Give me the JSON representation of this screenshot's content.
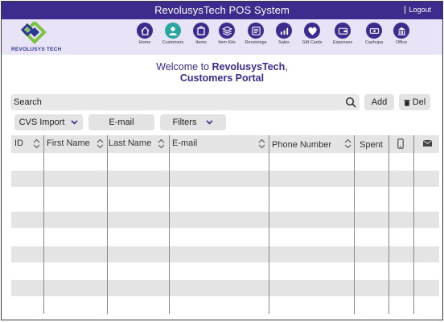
{
  "window": {
    "title": "RevolusysTech POS System",
    "logout_label": "Logout"
  },
  "brand": {
    "logo_text": "REVOLUSYS TECH"
  },
  "nav": [
    {
      "label": "Home",
      "icon": "home-icon"
    },
    {
      "label": "Customers",
      "icon": "customers-icon",
      "active": true
    },
    {
      "label": "Items",
      "icon": "items-icon"
    },
    {
      "label": "Item Kits",
      "icon": "item-kits-icon"
    },
    {
      "label": "Receivings",
      "icon": "receivings-icon"
    },
    {
      "label": "Sales",
      "icon": "sales-icon"
    },
    {
      "label": "Gift Cards",
      "icon": "gift-cards-icon"
    },
    {
      "label": "Expenses",
      "icon": "expenses-icon"
    },
    {
      "label": "Cashupa",
      "icon": "cashup-icon"
    },
    {
      "label": "Office",
      "icon": "office-icon"
    }
  ],
  "welcome": {
    "prefix": "Welcome to ",
    "brand": "RevolusysTech",
    "suffix": ",",
    "line2": "Customers Portal"
  },
  "search": {
    "placeholder": "Search",
    "value": ""
  },
  "toolbar": {
    "add_label": "Add",
    "delete_label": "Del",
    "cvs_import_label": "CVS Import",
    "email_label": "E-mail",
    "filters_label": "Filters"
  },
  "table": {
    "columns": [
      "ID",
      "First Name",
      "Last Name",
      "E-mail",
      "Phone Number",
      "Spent",
      "phone-icon",
      "mail-icon"
    ],
    "rows": []
  },
  "colors": {
    "primary": "#3d2b8e",
    "nav_band": "#e9e3f8",
    "active": "#2aa6a0",
    "logo_green": "#7cc143",
    "logo_blue": "#2b3a8e"
  }
}
